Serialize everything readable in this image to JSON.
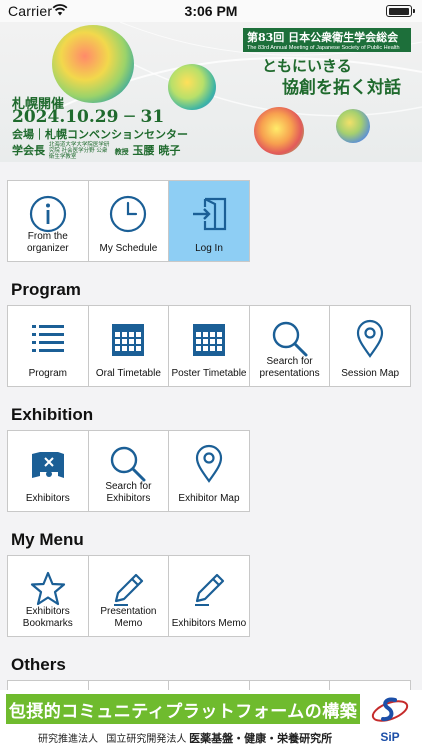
{
  "status_bar": {
    "carrier": "Carrier",
    "time": "3:06 PM"
  },
  "banner": {
    "conference_number": "第83回",
    "conference_title": "日本公衆衛生学会総会",
    "conference_english": "The 83rd Annual Meeting of Japanese Society of Public Health",
    "slogan_line1": "ともにいきる",
    "slogan_line2": "協創を拓く対話",
    "location_tag": "札幌開催",
    "dates": "2024.10.29 ─ 31",
    "venue": "会場｜札幌コンベンションセンター",
    "chair_label": "学会長",
    "chair_affiliation": "北海道大学大学院医学研究院 社会医学分野 公衆衛生学教室",
    "chair_title": "教授",
    "chair_name": "玉腰 暁子"
  },
  "top_tiles": [
    {
      "label": "From the organizer",
      "icon": "info-icon"
    },
    {
      "label": "My Schedule",
      "icon": "clock-icon"
    },
    {
      "label": "Log In",
      "icon": "login-icon",
      "active": true
    }
  ],
  "sections": {
    "program": {
      "title": "Program",
      "items": [
        {
          "label": "Program",
          "icon": "list-icon"
        },
        {
          "label": "Oral Timetable",
          "icon": "calendar-icon"
        },
        {
          "label": "Poster Timetable",
          "icon": "calendar-icon"
        },
        {
          "label": "Search for presentations",
          "icon": "search-icon"
        },
        {
          "label": "Session Map",
          "icon": "map-pin-icon"
        }
      ]
    },
    "exhibition": {
      "title": "Exhibition",
      "items": [
        {
          "label": "Exhibitors",
          "icon": "exhibitor-booth-icon"
        },
        {
          "label": "Search for Exhibitors",
          "icon": "search-icon"
        },
        {
          "label": "Exhibitor Map",
          "icon": "map-pin-icon"
        }
      ]
    },
    "my_menu": {
      "title": "My Menu",
      "items": [
        {
          "label": "Exhibitors Bookmarks",
          "icon": "star-icon"
        },
        {
          "label": "Presentation Memo",
          "icon": "pencil-icon"
        },
        {
          "label": "Exhibitors Memo",
          "icon": "pencil-icon"
        }
      ]
    },
    "others": {
      "title": "Others"
    }
  },
  "ad_banner": {
    "headline": "包摂的コミュニティプラットフォームの構築",
    "org_prefix": "研究推進法人",
    "org_type": "国立研究開発法人",
    "org_name": "医薬基盤・健康・栄養研究所",
    "logo_text": "SiP"
  },
  "colors": {
    "icon_blue": "#1b5f96",
    "active_tile": "#8ecef4",
    "banner_green": "#1f6a2d",
    "ad_green": "#6fbb2e"
  }
}
